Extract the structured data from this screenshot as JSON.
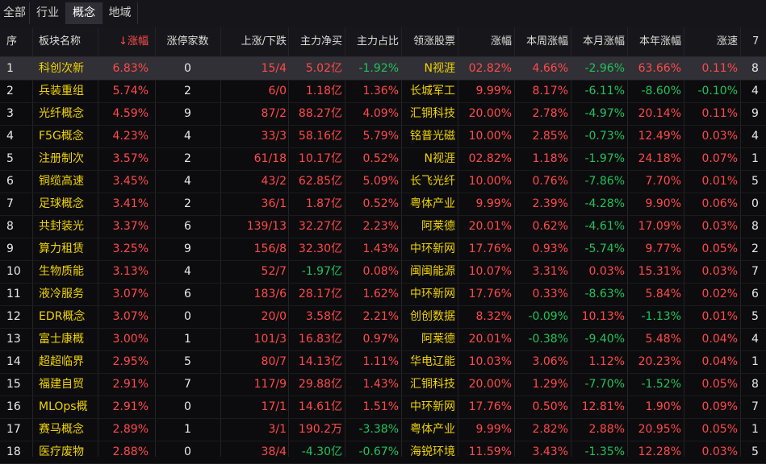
{
  "tabs": [
    {
      "label": "全部",
      "active": false
    },
    {
      "label": "行业",
      "active": false
    },
    {
      "label": "概念",
      "active": true
    },
    {
      "label": "地域",
      "active": false
    }
  ],
  "columns": [
    {
      "label": "序"
    },
    {
      "label": "板块名称"
    },
    {
      "label": "↓涨幅",
      "sorted": true
    },
    {
      "label": "涨停家数"
    },
    {
      "label": "上涨/下跌"
    },
    {
      "label": "主力净买"
    },
    {
      "label": "主力占比"
    },
    {
      "label": "领涨股票"
    },
    {
      "label": "涨幅"
    },
    {
      "label": "本周涨幅"
    },
    {
      "label": "本月涨幅"
    },
    {
      "label": "本年涨幅"
    },
    {
      "label": "涨速"
    },
    {
      "label": "7"
    }
  ],
  "colors": {
    "up": "#ff4a4a",
    "down": "#22c25a",
    "name": "#f0d200",
    "neutral": "#e8e8e8"
  },
  "rows": [
    {
      "idx": "1",
      "name": "科创次新",
      "chg": "6.83%",
      "limit": "0",
      "updown": "15/4",
      "net": "5.02亿",
      "net_dir": "up",
      "ratio": "-1.92%",
      "ratio_dir": "down",
      "lead": "N视涯",
      "lead_chg": "02.82%",
      "lead_dir": "up",
      "week": "4.66%",
      "week_dir": "up",
      "month": "-2.96%",
      "month_dir": "down",
      "year": "63.66%",
      "year_dir": "up",
      "speed": "0.11%",
      "speed_dir": "up",
      "extra": "8"
    },
    {
      "idx": "2",
      "name": "兵装重组",
      "chg": "5.74%",
      "limit": "2",
      "updown": "6/0",
      "net": "1.18亿",
      "net_dir": "up",
      "ratio": "1.36%",
      "ratio_dir": "up",
      "lead": "长城军工",
      "lead_chg": "9.99%",
      "lead_dir": "up",
      "week": "8.17%",
      "week_dir": "up",
      "month": "-6.11%",
      "month_dir": "down",
      "year": "-8.60%",
      "year_dir": "down",
      "speed": "-0.10%",
      "speed_dir": "down",
      "extra": "4"
    },
    {
      "idx": "3",
      "name": "光纤概念",
      "chg": "4.59%",
      "limit": "9",
      "updown": "87/2",
      "net": "88.27亿",
      "net_dir": "up",
      "ratio": "4.09%",
      "ratio_dir": "up",
      "lead": "汇铜科技",
      "lead_chg": "20.00%",
      "lead_dir": "up",
      "week": "2.78%",
      "week_dir": "up",
      "month": "-4.97%",
      "month_dir": "down",
      "year": "20.14%",
      "year_dir": "up",
      "speed": "0.11%",
      "speed_dir": "up",
      "extra": "9"
    },
    {
      "idx": "4",
      "name": "F5G概念",
      "chg": "4.23%",
      "limit": "4",
      "updown": "33/3",
      "net": "58.16亿",
      "net_dir": "up",
      "ratio": "5.79%",
      "ratio_dir": "up",
      "lead": "铭普光磁",
      "lead_chg": "10.00%",
      "lead_dir": "up",
      "week": "2.85%",
      "week_dir": "up",
      "month": "-0.73%",
      "month_dir": "down",
      "year": "12.49%",
      "year_dir": "up",
      "speed": "0.03%",
      "speed_dir": "up",
      "extra": "4"
    },
    {
      "idx": "5",
      "name": "注册制次",
      "chg": "3.57%",
      "limit": "2",
      "updown": "61/18",
      "net": "10.17亿",
      "net_dir": "up",
      "ratio": "0.52%",
      "ratio_dir": "up",
      "lead": "N视涯",
      "lead_chg": "02.82%",
      "lead_dir": "up",
      "week": "1.18%",
      "week_dir": "up",
      "month": "-1.97%",
      "month_dir": "down",
      "year": "24.18%",
      "year_dir": "up",
      "speed": "0.07%",
      "speed_dir": "up",
      "extra": "1"
    },
    {
      "idx": "6",
      "name": "铜缆高速",
      "chg": "3.45%",
      "limit": "4",
      "updown": "43/2",
      "net": "62.85亿",
      "net_dir": "up",
      "ratio": "5.09%",
      "ratio_dir": "up",
      "lead": "长飞光纤",
      "lead_chg": "10.00%",
      "lead_dir": "up",
      "week": "0.76%",
      "week_dir": "up",
      "month": "-7.86%",
      "month_dir": "down",
      "year": "7.70%",
      "year_dir": "up",
      "speed": "0.01%",
      "speed_dir": "up",
      "extra": "5"
    },
    {
      "idx": "7",
      "name": "足球概念",
      "chg": "3.41%",
      "limit": "2",
      "updown": "36/1",
      "net": "1.87亿",
      "net_dir": "up",
      "ratio": "0.52%",
      "ratio_dir": "up",
      "lead": "粤体产业",
      "lead_chg": "9.99%",
      "lead_dir": "up",
      "week": "2.39%",
      "week_dir": "up",
      "month": "-4.28%",
      "month_dir": "down",
      "year": "9.90%",
      "year_dir": "up",
      "speed": "0.06%",
      "speed_dir": "up",
      "extra": "0"
    },
    {
      "idx": "8",
      "name": "共封装光",
      "chg": "3.37%",
      "limit": "6",
      "updown": "139/13",
      "net": "32.27亿",
      "net_dir": "up",
      "ratio": "2.23%",
      "ratio_dir": "up",
      "lead": "阿莱德",
      "lead_chg": "20.01%",
      "lead_dir": "up",
      "week": "0.62%",
      "week_dir": "up",
      "month": "-4.61%",
      "month_dir": "down",
      "year": "17.09%",
      "year_dir": "up",
      "speed": "0.03%",
      "speed_dir": "up",
      "extra": "8"
    },
    {
      "idx": "9",
      "name": "算力租赁",
      "chg": "3.25%",
      "limit": "9",
      "updown": "156/8",
      "net": "32.30亿",
      "net_dir": "up",
      "ratio": "1.43%",
      "ratio_dir": "up",
      "lead": "中环新网",
      "lead_chg": "17.76%",
      "lead_dir": "up",
      "week": "0.93%",
      "week_dir": "up",
      "month": "-5.74%",
      "month_dir": "down",
      "year": "9.77%",
      "year_dir": "up",
      "speed": "0.05%",
      "speed_dir": "up",
      "extra": "2"
    },
    {
      "idx": "10",
      "name": "生物质能",
      "chg": "3.13%",
      "limit": "4",
      "updown": "52/7",
      "net": "-1.97亿",
      "net_dir": "down",
      "ratio": "0.08%",
      "ratio_dir": "up",
      "lead": "闽闽能源",
      "lead_chg": "10.07%",
      "lead_dir": "up",
      "week": "3.31%",
      "week_dir": "up",
      "month": "0.03%",
      "month_dir": "up",
      "year": "15.31%",
      "year_dir": "up",
      "speed": "0.03%",
      "speed_dir": "up",
      "extra": "7"
    },
    {
      "idx": "11",
      "name": "液冷服务",
      "chg": "3.07%",
      "limit": "6",
      "updown": "183/6",
      "net": "28.17亿",
      "net_dir": "up",
      "ratio": "1.62%",
      "ratio_dir": "up",
      "lead": "中环新网",
      "lead_chg": "17.76%",
      "lead_dir": "up",
      "week": "0.33%",
      "week_dir": "up",
      "month": "-8.63%",
      "month_dir": "down",
      "year": "5.84%",
      "year_dir": "up",
      "speed": "0.02%",
      "speed_dir": "up",
      "extra": "6"
    },
    {
      "idx": "12",
      "name": "EDR概念",
      "chg": "3.07%",
      "limit": "0",
      "updown": "20/0",
      "net": "3.58亿",
      "net_dir": "up",
      "ratio": "2.21%",
      "ratio_dir": "up",
      "lead": "创创数据",
      "lead_chg": "8.32%",
      "lead_dir": "up",
      "week": "-0.09%",
      "week_dir": "down",
      "month": "10.13%",
      "month_dir": "up",
      "year": "-1.13%",
      "year_dir": "down",
      "speed": "0.01%",
      "speed_dir": "up",
      "extra": "5"
    },
    {
      "idx": "13",
      "name": "富士康概",
      "chg": "3.00%",
      "limit": "1",
      "updown": "101/3",
      "net": "16.83亿",
      "net_dir": "up",
      "ratio": "0.97%",
      "ratio_dir": "up",
      "lead": "阿莱德",
      "lead_chg": "20.01%",
      "lead_dir": "up",
      "week": "-0.38%",
      "week_dir": "down",
      "month": "-9.40%",
      "month_dir": "down",
      "year": "5.48%",
      "year_dir": "up",
      "speed": "0.04%",
      "speed_dir": "up",
      "extra": "4"
    },
    {
      "idx": "14",
      "name": "超超临界",
      "chg": "2.95%",
      "limit": "5",
      "updown": "80/7",
      "net": "14.13亿",
      "net_dir": "up",
      "ratio": "1.11%",
      "ratio_dir": "up",
      "lead": "华电辽能",
      "lead_chg": "10.03%",
      "lead_dir": "up",
      "week": "3.06%",
      "week_dir": "up",
      "month": "1.12%",
      "month_dir": "up",
      "year": "20.23%",
      "year_dir": "up",
      "speed": "0.04%",
      "speed_dir": "up",
      "extra": "1"
    },
    {
      "idx": "15",
      "name": "福建自贸",
      "chg": "2.91%",
      "limit": "7",
      "updown": "117/9",
      "net": "29.88亿",
      "net_dir": "up",
      "ratio": "1.43%",
      "ratio_dir": "up",
      "lead": "汇铜科技",
      "lead_chg": "20.00%",
      "lead_dir": "up",
      "week": "1.29%",
      "week_dir": "up",
      "month": "-7.70%",
      "month_dir": "down",
      "year": "-1.52%",
      "year_dir": "down",
      "speed": "0.05%",
      "speed_dir": "up",
      "extra": "8"
    },
    {
      "idx": "16",
      "name": "MLOps概",
      "chg": "2.91%",
      "limit": "0",
      "updown": "17/1",
      "net": "14.61亿",
      "net_dir": "up",
      "ratio": "1.51%",
      "ratio_dir": "up",
      "lead": "中环新网",
      "lead_chg": "17.76%",
      "lead_dir": "up",
      "week": "0.50%",
      "week_dir": "up",
      "month": "12.81%",
      "month_dir": "up",
      "year": "1.90%",
      "year_dir": "up",
      "speed": "0.09%",
      "speed_dir": "up",
      "extra": "7"
    },
    {
      "idx": "17",
      "name": "赛马概念",
      "chg": "2.89%",
      "limit": "1",
      "updown": "3/1",
      "net": "190.2万",
      "net_dir": "up",
      "ratio": "-3.38%",
      "ratio_dir": "down",
      "lead": "粤体产业",
      "lead_chg": "9.99%",
      "lead_dir": "up",
      "week": "2.82%",
      "week_dir": "up",
      "month": "2.88%",
      "month_dir": "up",
      "year": "20.95%",
      "year_dir": "up",
      "speed": "0.05%",
      "speed_dir": "up",
      "extra": "1"
    },
    {
      "idx": "18",
      "name": "医疗废物",
      "chg": "2.88%",
      "limit": "0",
      "updown": "38/4",
      "net": "-4.30亿",
      "net_dir": "down",
      "ratio": "-0.67%",
      "ratio_dir": "down",
      "lead": "海锐环境",
      "lead_chg": "11.59%",
      "lead_dir": "up",
      "week": "3.43%",
      "week_dir": "up",
      "month": "-1.35%",
      "month_dir": "down",
      "year": "12.28%",
      "year_dir": "up",
      "speed": "0.03%",
      "speed_dir": "up",
      "extra": "5"
    }
  ]
}
